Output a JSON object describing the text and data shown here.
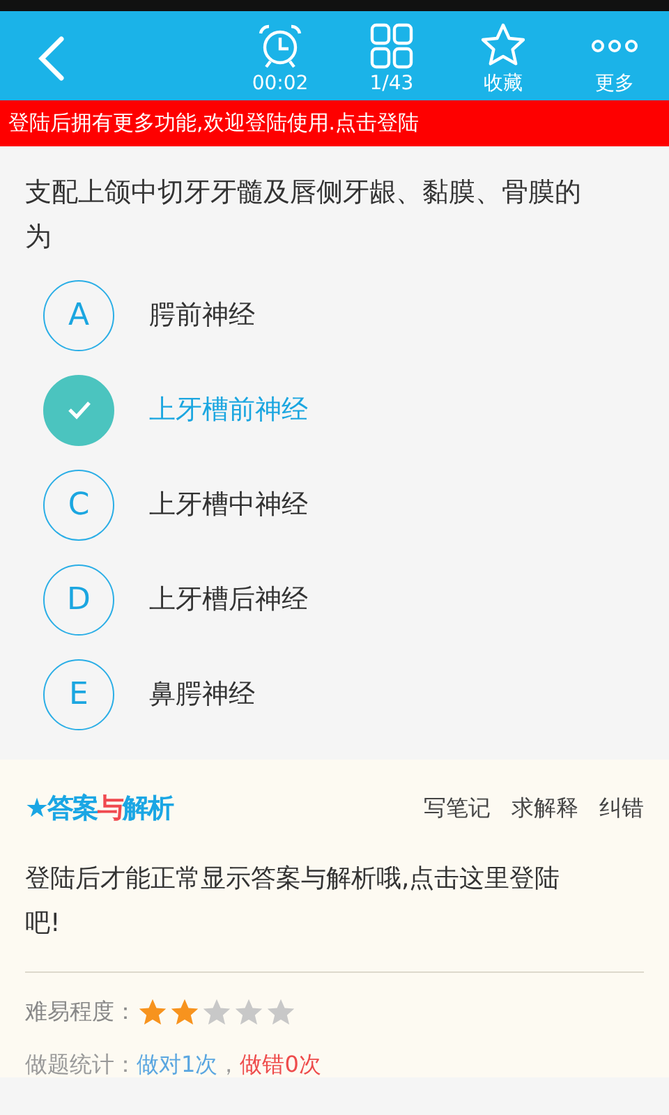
{
  "toolbar": {
    "items": [
      {
        "kind": "clock",
        "label": "00:02"
      },
      {
        "kind": "grid",
        "label": "1/43"
      },
      {
        "kind": "star",
        "label": "收藏"
      },
      {
        "kind": "more",
        "label": "更多"
      }
    ]
  },
  "login_banner": "登陆后拥有更多功能,欢迎登陆使用.点击登陆",
  "question": "支配上颌中切牙牙髓及唇侧牙龈、黏膜、骨膜的为",
  "options": [
    {
      "letter": "A",
      "text": "腭前神经",
      "selected": false
    },
    {
      "text": "上牙槽前神经",
      "selected": true
    },
    {
      "letter": "C",
      "text": "上牙槽中神经",
      "selected": false
    },
    {
      "letter": "D",
      "text": "上牙槽后神经",
      "selected": false
    },
    {
      "letter": "E",
      "text": "鼻腭神经",
      "selected": false
    }
  ],
  "answer_section": {
    "title_parts": [
      {
        "text": "★",
        "color": "#1aa6e4"
      },
      {
        "text": "答案",
        "color": "#1aa6e4"
      },
      {
        "text": "与",
        "color": "#f0494f"
      },
      {
        "text": "解析",
        "color": "#1aa6e4"
      }
    ],
    "actions": [
      "写笔记",
      "求解释",
      "纠错"
    ],
    "message": "登陆后才能正常显示答案与解析哦,点击这里登陆吧!",
    "difficulty_label": "难易程度：",
    "stars": 2,
    "stats_label": "做题统计：",
    "correct": "做对1次",
    "separator": "，",
    "wrong": "做错0次"
  }
}
